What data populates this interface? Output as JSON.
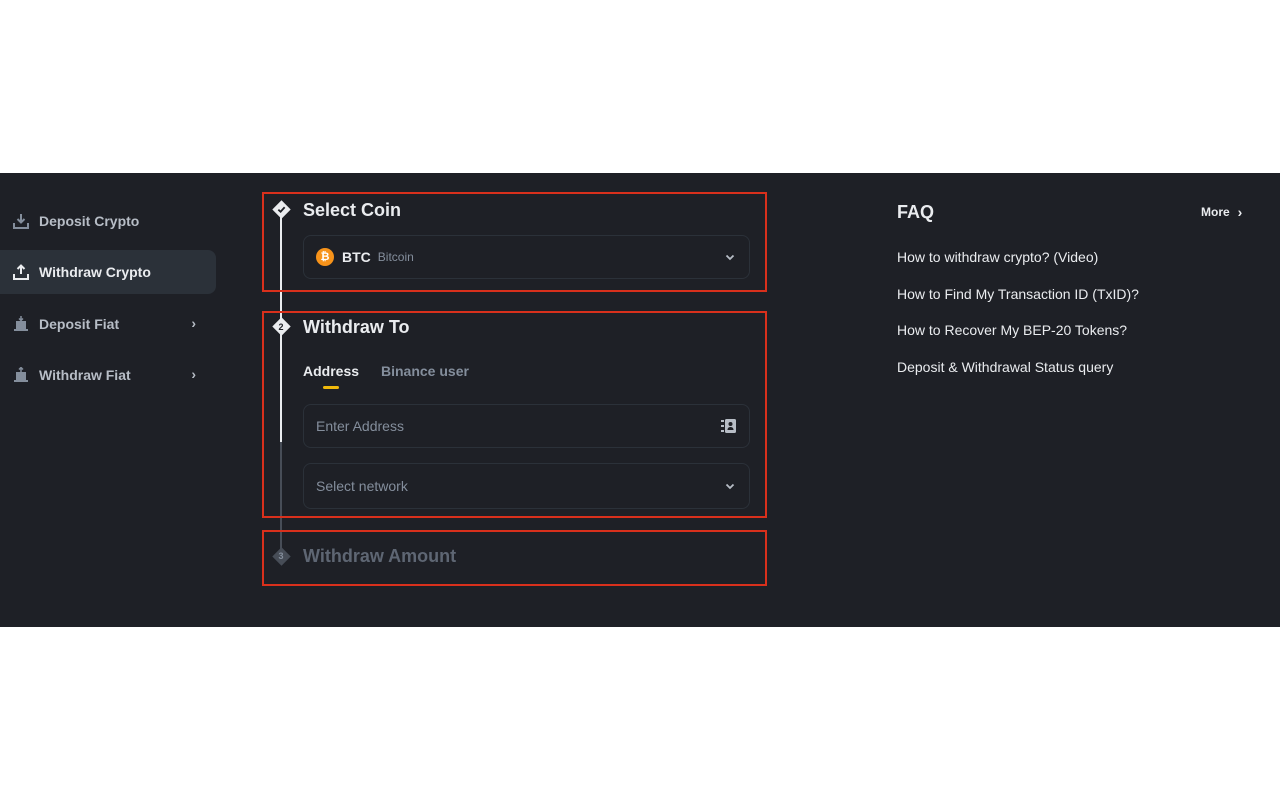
{
  "sidebar": {
    "items": [
      {
        "label": "Deposit Crypto",
        "icon": "download-icon",
        "active": false
      },
      {
        "label": "Withdraw Crypto",
        "icon": "upload-icon",
        "active": true
      },
      {
        "label": "Deposit Fiat",
        "icon": "deposit-fiat-icon",
        "active": false
      },
      {
        "label": "Withdraw Fiat",
        "icon": "withdraw-fiat-icon",
        "active": false
      }
    ]
  },
  "steps": {
    "select_coin": {
      "title": "Select Coin",
      "coin_symbol": "BTC",
      "coin_name": "Bitcoin",
      "coin_glyph": "₿"
    },
    "withdraw_to": {
      "number": "2",
      "title": "Withdraw To",
      "tabs": [
        "Address",
        "Binance user"
      ],
      "address_placeholder": "Enter Address",
      "network_placeholder": "Select network"
    },
    "withdraw_amount": {
      "number": "3",
      "title": "Withdraw Amount"
    }
  },
  "faq": {
    "title": "FAQ",
    "more_label": "More",
    "links": [
      "How to withdraw crypto? (Video)",
      "How to Find My Transaction ID (TxID)?",
      "How to Recover My BEP-20 Tokens?",
      "Deposit & Withdrawal Status query"
    ]
  },
  "colors": {
    "background": "#1e2026",
    "accent": "#f0b90b",
    "highlight_outline": "#d9301c",
    "btc": "#f7931a"
  }
}
